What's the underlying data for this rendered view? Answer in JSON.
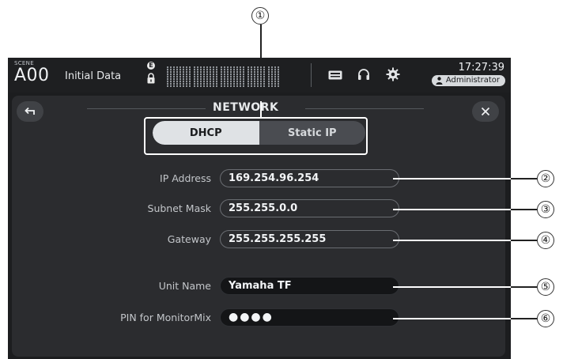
{
  "status_bar": {
    "scene_label": "SCENE",
    "scene_number": "A00",
    "scene_name": "Initial Data",
    "encoder_badge": "E",
    "time": "17:27:39",
    "user": "Administrator",
    "icons": [
      "lock-icon",
      "sd-card-icon",
      "headphones-icon",
      "gear-icon"
    ]
  },
  "panel": {
    "title": "NETWORK",
    "back_icon": "back-arrow-icon",
    "close_icon": "close-icon",
    "mode": {
      "options": [
        "DHCP",
        "Static IP"
      ],
      "selected": "DHCP"
    },
    "fields": {
      "ip_address": {
        "label": "IP Address",
        "value": "169.254.96.254"
      },
      "subnet_mask": {
        "label": "Subnet Mask",
        "value": "255.255.0.0"
      },
      "gateway": {
        "label": "Gateway",
        "value": "255.255.255.255"
      },
      "unit_name": {
        "label": "Unit Name",
        "value": "Yamaha TF"
      },
      "pin": {
        "label": "PIN for MonitorMix",
        "value": "●●●●"
      }
    }
  },
  "callouts": [
    "①",
    "②",
    "③",
    "④",
    "⑤",
    "⑥"
  ]
}
